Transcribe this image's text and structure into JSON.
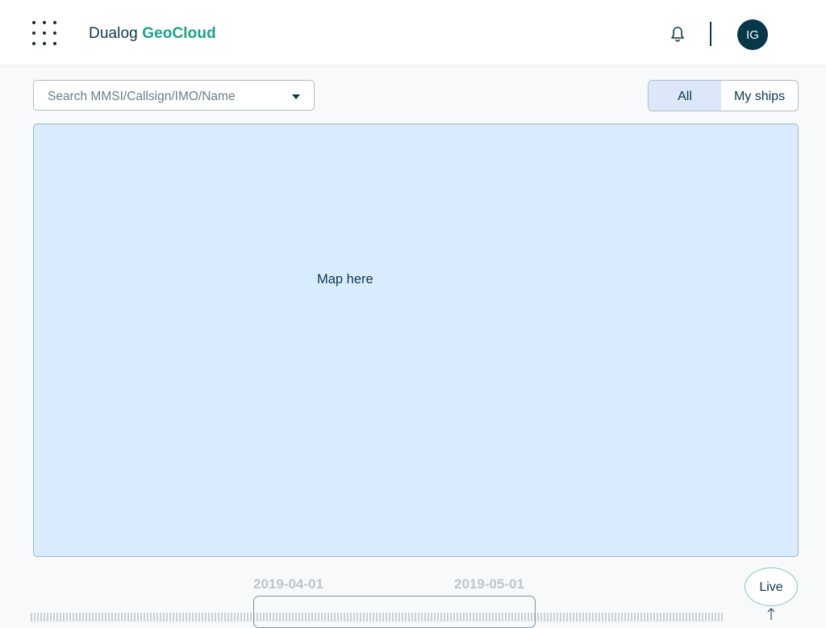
{
  "header": {
    "brand_part1": "Dualog",
    "brand_part2": "GeoCloud",
    "avatar_initials": "IG",
    "icons": [
      "apps-grid-icon",
      "bell-icon"
    ]
  },
  "search": {
    "placeholder": "Search MMSI/Callsign/IMO/Name",
    "value": ""
  },
  "filter": {
    "options": [
      "All",
      "My ships"
    ],
    "selected": "All"
  },
  "map": {
    "placeholder_text": "Map here"
  },
  "timeline": {
    "dates": [
      "2019-04-01",
      "2019-05-01"
    ],
    "live_label": "Live"
  },
  "colors": {
    "brand_accent": "#1aa385",
    "primary_dark": "#06384a",
    "map_background": "#d9ecfd",
    "selected_toggle": "#dce7fa"
  }
}
